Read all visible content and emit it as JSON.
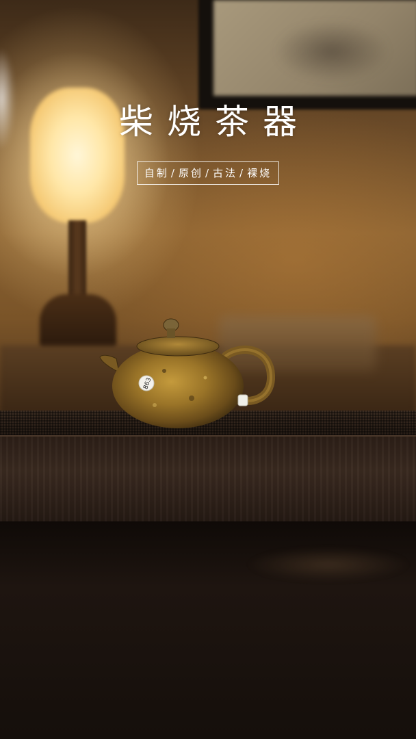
{
  "title": "柴烧茶器",
  "tagline": [
    "自制",
    "原创",
    "古法",
    "裸烧"
  ],
  "tagline_separator": "/",
  "pot_label": "863",
  "colors": {
    "wall": "#8a6232",
    "lamp": "#ffe7a8",
    "tray": "#2c1f17",
    "teapot": "#8a6a24",
    "text": "#ffffff"
  }
}
